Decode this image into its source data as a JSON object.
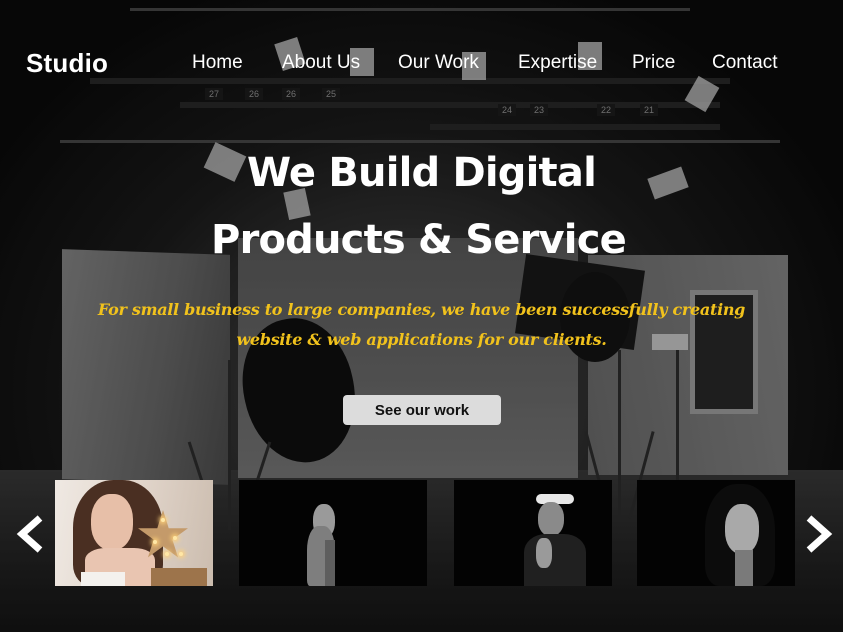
{
  "brand": {
    "name": "Studio"
  },
  "nav": {
    "items": [
      {
        "id": "home",
        "label": "Home"
      },
      {
        "id": "about",
        "label": "About Us"
      },
      {
        "id": "work",
        "label": "Our Work"
      },
      {
        "id": "expertise",
        "label": "Expertise"
      },
      {
        "id": "price",
        "label": "Price"
      },
      {
        "id": "contact",
        "label": "Contact"
      }
    ]
  },
  "hero": {
    "title_line1": "We Build Digital",
    "title_line2": "Products & Service",
    "subtitle_line1": "For small business to large companies, we have been successfully creating",
    "subtitle_line2": "website & web applications for our clients.",
    "cta_label": "See our work",
    "accent_color": "#f1c21c"
  },
  "gallery": {
    "prev_icon": "chevron-left-icon",
    "next_icon": "chevron-right-icon",
    "photos": [
      {
        "id": "photo-1",
        "subject": "woman-with-star-lamp-photo"
      },
      {
        "id": "photo-2",
        "subject": "hand-over-face-portrait-photo"
      },
      {
        "id": "photo-3",
        "subject": "woman-in-visor-cap-photo"
      },
      {
        "id": "photo-4",
        "subject": "low-key-face-portrait-photo"
      }
    ]
  },
  "background": {
    "subject": "photo-studio-backdrop-image"
  }
}
